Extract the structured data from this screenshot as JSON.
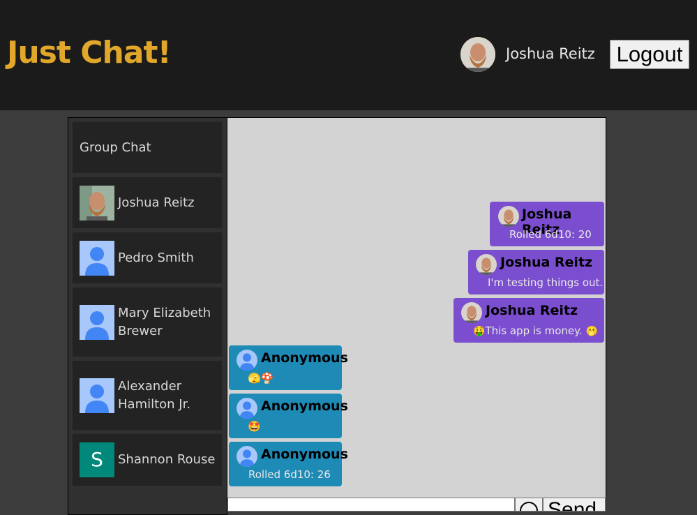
{
  "app": {
    "title": "Just Chat!"
  },
  "user": {
    "name": "Joshua Reitz",
    "logout_label": "Logout"
  },
  "rooms": [
    {
      "label": "Group Chat",
      "avatar": "none"
    },
    {
      "label": "Joshua Reitz",
      "avatar": "photo"
    },
    {
      "label": "Pedro Smith",
      "avatar": "default-person-icon"
    },
    {
      "label": "Mary Elizabeth Brewer",
      "avatar": "default-person-icon"
    },
    {
      "label": "Alexander Hamilton Jr.",
      "avatar": "default-person-icon"
    },
    {
      "label": "Shannon Rouse",
      "avatar": "letter",
      "letter": "S",
      "color": "#00897b"
    }
  ],
  "messages": [
    {
      "author": "Joshua Reitz",
      "text": "Rolled 6d10: 20",
      "mine": true
    },
    {
      "author": "Joshua Reitz",
      "text": "I'm testing things out.",
      "mine": true
    },
    {
      "author": "Joshua Reitz",
      "text_prefix_emoji": "🤑",
      "text": "This app is money.",
      "text_suffix_emoji": "🫢",
      "mine": true
    },
    {
      "author": "Anonymous",
      "emojis": "🫣🍄",
      "mine": false
    },
    {
      "author": "Anonymous",
      "emojis": "🤩",
      "mine": false
    },
    {
      "author": "Anonymous",
      "text": "Rolled 6d10: 26",
      "mine": false
    }
  ],
  "composer": {
    "send_label": "Send",
    "emoji_icon": "smiley-icon"
  },
  "colors": {
    "header_bg": "#1b1b1b",
    "brand": "#e0a72a",
    "my_message": "#7b4ecf",
    "other_message": "#1e8ab6",
    "chat_bg": "#d3d3d3"
  }
}
